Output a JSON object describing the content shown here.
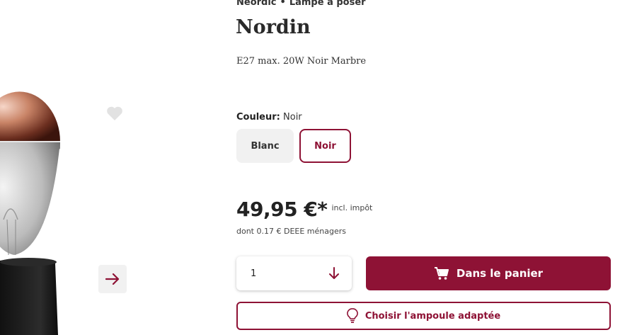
{
  "breadcrumb": {
    "brand": "Neordic",
    "separator": "•",
    "category": "Lampe à poser"
  },
  "product": {
    "title": "Nordin",
    "subtitle": "E27 max. 20W Noir Marbre"
  },
  "color": {
    "label": "Couleur:",
    "selected": "Noir",
    "options": [
      "Blanc",
      "Noir"
    ]
  },
  "price": {
    "amount": "49,95 €*",
    "tax_note": "incl. impôt",
    "deee": "dont 0.17 € DEEE ménagers"
  },
  "quantity": {
    "value": "1"
  },
  "buttons": {
    "add_to_cart": "Dans le panier",
    "choose_bulb": "Choisir l'ampoule adaptée"
  },
  "icons": {
    "favorite": "heart-icon",
    "next": "arrow-right-icon",
    "quantity": "arrow-down-icon",
    "cart": "cart-icon",
    "bulb": "lightbulb-icon"
  },
  "colors": {
    "accent": "#8e1235",
    "swatch_bg": "#f1f1f1"
  }
}
